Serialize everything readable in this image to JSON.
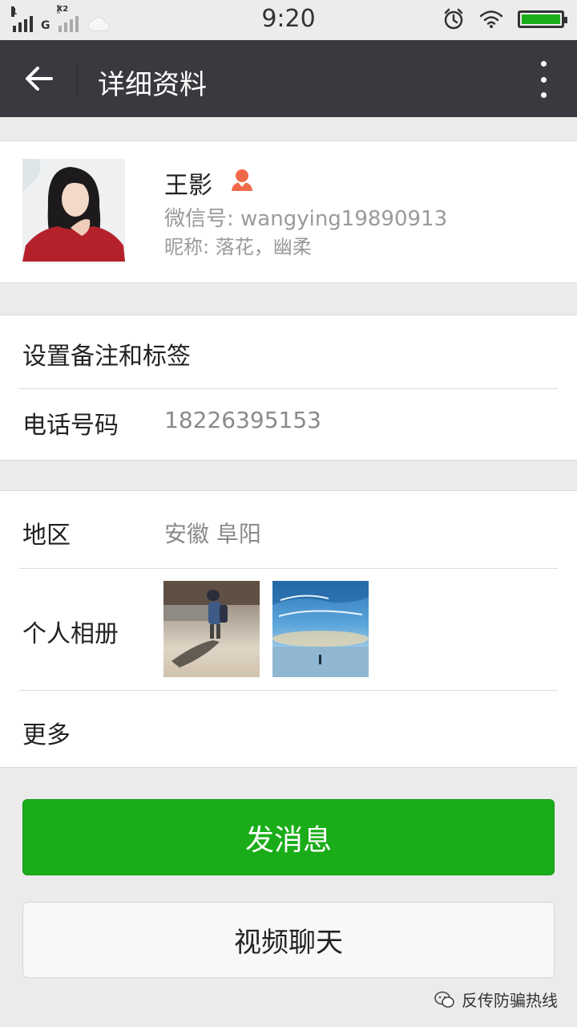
{
  "status_bar": {
    "sim1_label": "1",
    "network_label": "G",
    "sim2_label": "X2",
    "time": "9:20"
  },
  "header": {
    "title": "详细资料"
  },
  "profile": {
    "name": "王影",
    "wechat_id": "微信号: wangying19890913",
    "nickname": "昵称: 落花，幽柔"
  },
  "rows": {
    "remark_label": "设置备注和标签",
    "phone_label": "电话号码",
    "phone_value": "18226395153",
    "region_label": "地区",
    "region_value": "安徽  阜阳",
    "album_label": "个人相册",
    "more_label": "更多"
  },
  "actions": {
    "send_message": "发消息",
    "video_chat": "视频聊天"
  },
  "watermark": {
    "text": "反传防骗热线"
  },
  "colors": {
    "header_bg": "#393a3f",
    "primary_green": "#1aad19",
    "page_bg": "#ebebeb",
    "female_icon": "#f06a4a"
  }
}
